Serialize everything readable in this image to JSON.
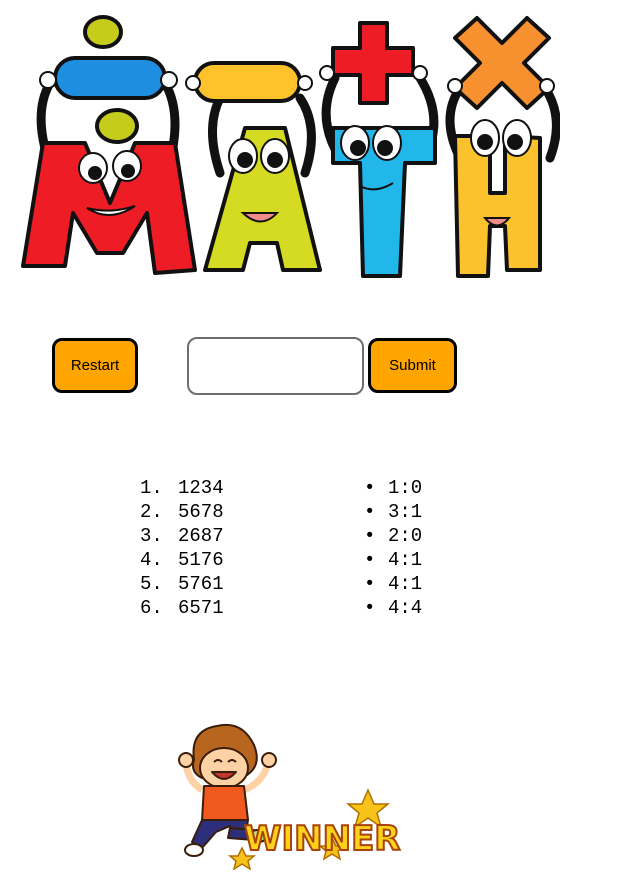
{
  "banner": {
    "letters": [
      {
        "char": "M",
        "color": "#ee1c25",
        "sign": "÷",
        "sign_color": "#1e8fe0"
      },
      {
        "char": "A",
        "color": "#d5da22",
        "sign": "−",
        "sign_color": "#ffc22a"
      },
      {
        "char": "T",
        "color": "#22b7ea",
        "sign": "+",
        "sign_color": "#ee1c25"
      },
      {
        "char": "H",
        "color": "#fcc22e",
        "sign": "×",
        "sign_color": "#f7902f"
      }
    ]
  },
  "controls": {
    "restart_label": "Restart",
    "submit_label": "Submit",
    "answer_value": "",
    "accent_color": "#ffa500"
  },
  "guesses": [
    {
      "num": "1.",
      "value": "1234"
    },
    {
      "num": "2.",
      "value": "5678"
    },
    {
      "num": "3.",
      "value": "2687"
    },
    {
      "num": "4.",
      "value": "5176"
    },
    {
      "num": "5.",
      "value": "5761"
    },
    {
      "num": "6.",
      "value": "6571"
    }
  ],
  "scores": [
    {
      "bullet": "•",
      "value": "1:0"
    },
    {
      "bullet": "•",
      "value": "3:1"
    },
    {
      "bullet": "•",
      "value": "2:0"
    },
    {
      "bullet": "•",
      "value": "4:1"
    },
    {
      "bullet": "•",
      "value": "4:1"
    },
    {
      "bullet": "•",
      "value": "4:4"
    }
  ],
  "winner": {
    "text": "WINNER!"
  }
}
